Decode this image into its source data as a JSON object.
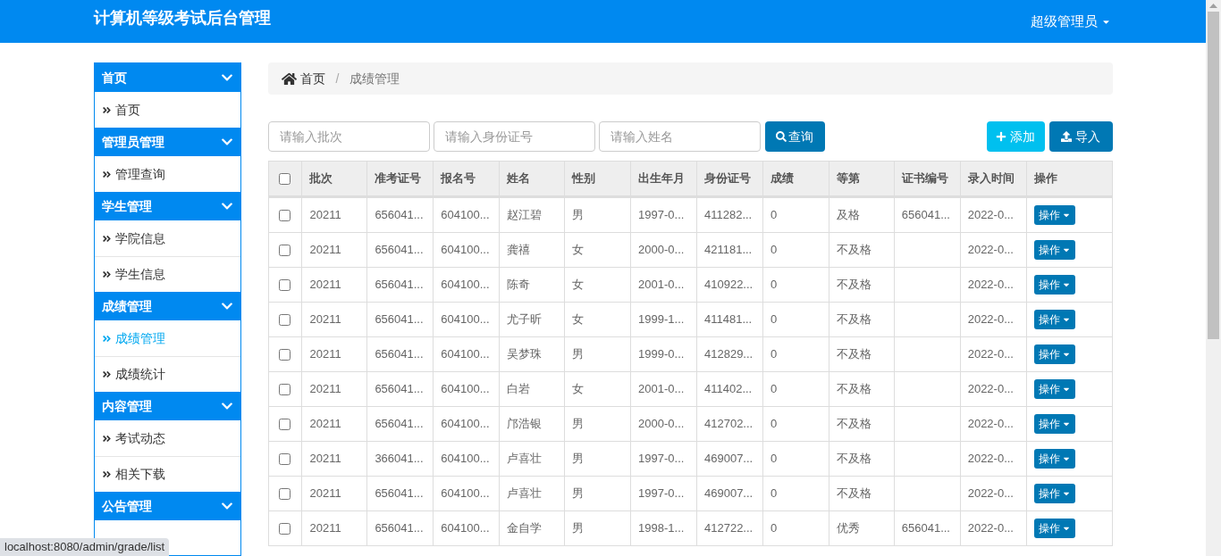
{
  "header": {
    "title": "计算机等级考试后台管理",
    "user": "超级管理员"
  },
  "sidebar": {
    "groups": [
      {
        "title": "首页",
        "expanded": true,
        "items": [
          {
            "label": "首页",
            "selected": false
          }
        ]
      },
      {
        "title": "管理员管理",
        "expanded": true,
        "items": [
          {
            "label": "管理查询",
            "selected": false
          }
        ]
      },
      {
        "title": "学生管理",
        "expanded": true,
        "items": [
          {
            "label": "学院信息",
            "selected": false
          },
          {
            "label": "学生信息",
            "selected": false
          }
        ]
      },
      {
        "title": "成绩管理",
        "expanded": true,
        "items": [
          {
            "label": "成绩管理",
            "selected": true
          },
          {
            "label": "成绩统计",
            "selected": false
          }
        ]
      },
      {
        "title": "内容管理",
        "expanded": true,
        "items": [
          {
            "label": "考试动态",
            "selected": false
          },
          {
            "label": "相关下载",
            "selected": false
          }
        ]
      },
      {
        "title": "公告管理",
        "expanded": true
      }
    ]
  },
  "breadcrumb_separator": "/",
  "breadcrumb": [
    {
      "label": "首页",
      "kind": "home"
    },
    {
      "label": "成绩管理",
      "kind": "current"
    }
  ],
  "search": {
    "fields": [
      {
        "placeholder": "请输入批次"
      },
      {
        "placeholder": "请输入身份证号"
      },
      {
        "placeholder": "请输入姓名"
      }
    ],
    "button": "查询"
  },
  "actions": [
    {
      "label": "添加",
      "kind": "add"
    },
    {
      "label": "导入",
      "kind": "import"
    }
  ],
  "table": {
    "select_all": {
      "checked": false
    },
    "columns": [
      "批次",
      "准考证号",
      "报名号",
      "姓名",
      "性别",
      "出生年月",
      "身份证号",
      "成绩",
      "等第",
      "证书编号",
      "录入时间",
      "操作"
    ],
    "rows": [
      {
        "selected": false,
        "cells": [
          "20211",
          "656041...",
          "604100...",
          "赵江碧",
          "男",
          "1997-0...",
          "411282...",
          "0",
          "及格",
          "656041...",
          "2022-0..."
        ],
        "action": "操作"
      },
      {
        "selected": false,
        "cells": [
          "20211",
          "656041...",
          "604100...",
          "龚禧",
          "女",
          "2000-0...",
          "421181...",
          "0",
          "不及格",
          "",
          "2022-0..."
        ],
        "action": "操作"
      },
      {
        "selected": false,
        "cells": [
          "20211",
          "656041...",
          "604100...",
          "陈奇",
          "女",
          "2001-0...",
          "410922...",
          "0",
          "不及格",
          "",
          "2022-0..."
        ],
        "action": "操作"
      },
      {
        "selected": false,
        "cells": [
          "20211",
          "656041...",
          "604100...",
          "尤子昕",
          "女",
          "1999-1...",
          "411481...",
          "0",
          "不及格",
          "",
          "2022-0..."
        ],
        "action": "操作"
      },
      {
        "selected": false,
        "cells": [
          "20211",
          "656041...",
          "604100...",
          "吴梦珠",
          "男",
          "1999-0...",
          "412829...",
          "0",
          "不及格",
          "",
          "2022-0..."
        ],
        "action": "操作"
      },
      {
        "selected": false,
        "cells": [
          "20211",
          "656041...",
          "604100...",
          "白岩",
          "女",
          "2001-0...",
          "411402...",
          "0",
          "不及格",
          "",
          "2022-0..."
        ],
        "action": "操作"
      },
      {
        "selected": false,
        "cells": [
          "20211",
          "656041...",
          "604100...",
          "邝浩银",
          "男",
          "2000-0...",
          "412702...",
          "0",
          "不及格",
          "",
          "2022-0..."
        ],
        "action": "操作"
      },
      {
        "selected": false,
        "cells": [
          "20211",
          "366041...",
          "604100...",
          "卢喜壮",
          "男",
          "1997-0...",
          "469007...",
          "0",
          "不及格",
          "",
          "2022-0..."
        ],
        "action": "操作"
      },
      {
        "selected": false,
        "cells": [
          "20211",
          "656041...",
          "604100...",
          "卢喜壮",
          "男",
          "1997-0...",
          "469007...",
          "0",
          "不及格",
          "",
          "2022-0..."
        ],
        "action": "操作"
      },
      {
        "selected": false,
        "cells": [
          "20211",
          "656041...",
          "604100...",
          "金自学",
          "男",
          "1998-1...",
          "412722...",
          "0",
          "优秀",
          "656041...",
          "2022-0..."
        ],
        "action": "操作"
      }
    ]
  },
  "status_bar": {
    "url": "localhost:8080/admin/grade/list"
  }
}
